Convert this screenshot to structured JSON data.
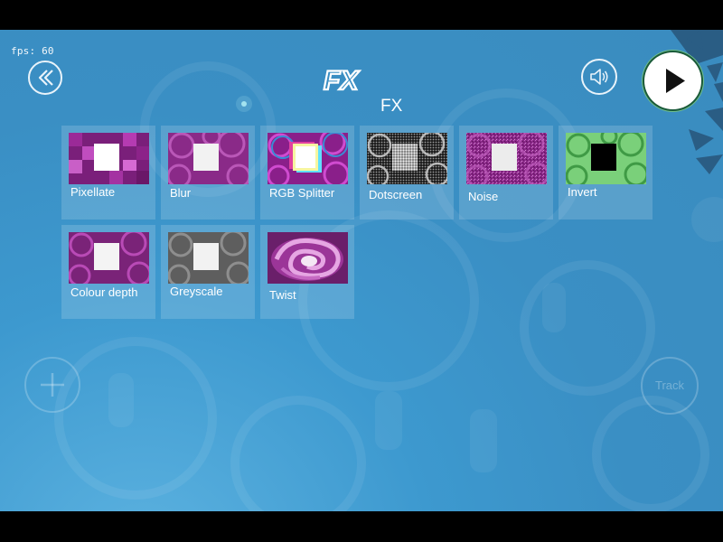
{
  "hud": {
    "fps_text": "fps: 60"
  },
  "header": {
    "title": "FX",
    "logo_text": "FX"
  },
  "effects": [
    {
      "label": "Pixellate",
      "icon": "pixellate-thumbnail"
    },
    {
      "label": "Blur",
      "icon": "blur-thumbnail"
    },
    {
      "label": "RGB Splitter",
      "icon": "rgb-splitter-thumbnail"
    },
    {
      "label": "Dotscreen",
      "icon": "dotscreen-thumbnail"
    },
    {
      "label": "Noise",
      "icon": "noise-thumbnail"
    },
    {
      "label": "Invert",
      "icon": "invert-thumbnail"
    },
    {
      "label": "Colour depth",
      "icon": "colour-depth-thumbnail"
    },
    {
      "label": "Greyscale",
      "icon": "greyscale-thumbnail"
    },
    {
      "label": "Twist",
      "icon": "twist-thumbnail"
    }
  ],
  "footer": {
    "track_label": "Track"
  },
  "colors": {
    "background": "#3a8fc4",
    "accent_magenta": "#b43ab5",
    "invert_green": "#7ad07a"
  }
}
